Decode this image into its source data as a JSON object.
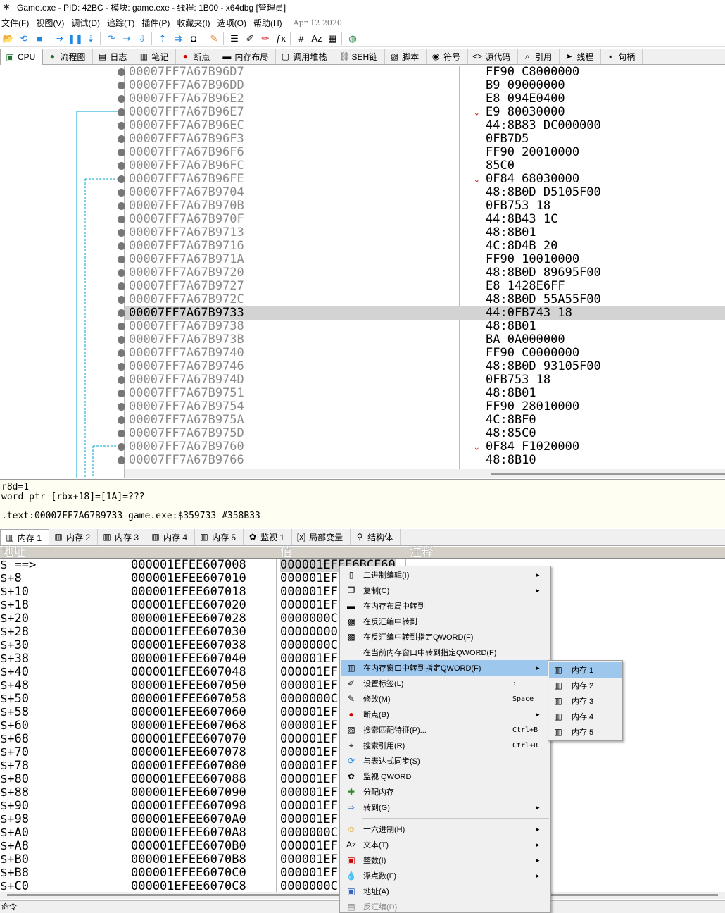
{
  "window": {
    "title": "Game.exe - PID: 42BC - 模块: game.exe - 线程: 1B00 - x64dbg [管理员]"
  },
  "menu": {
    "items": [
      "文件(F)",
      "视图(V)",
      "调试(D)",
      "追踪(T)",
      "插件(P)",
      "收藏夹(I)",
      "选项(O)",
      "帮助(H)"
    ],
    "date": "Apr 12 2020"
  },
  "toolbar": {
    "icons": [
      "open-icon",
      "restart-icon",
      "stop-icon",
      "run-icon",
      "pause-icon",
      "step-into-icon",
      "step-over-icon",
      "trace-into-icon",
      "trace-over-icon",
      "execute-till-return-icon",
      "run-to-user-code-icon",
      "scylla-icon",
      "patch-icon",
      "comment-icon",
      "label-icon",
      "bookmark-icon",
      "function-icon",
      "hash-icon",
      "strings-icon",
      "calculator-icon",
      "globe-icon"
    ]
  },
  "top_tabs": [
    {
      "icon": "cpu-icon",
      "label": "CPU"
    },
    {
      "icon": "graph-icon",
      "label": "流程图"
    },
    {
      "icon": "log-icon",
      "label": "日志"
    },
    {
      "icon": "notes-icon",
      "label": "笔记"
    },
    {
      "icon": "breakpoint-icon",
      "label": "断点"
    },
    {
      "icon": "memory-map-icon",
      "label": "内存布局"
    },
    {
      "icon": "callstack-icon",
      "label": "调用堆栈"
    },
    {
      "icon": "seh-icon",
      "label": "SEH链"
    },
    {
      "icon": "script-icon",
      "label": "脚本"
    },
    {
      "icon": "symbol-icon",
      "label": "符号"
    },
    {
      "icon": "source-icon",
      "label": "源代码"
    },
    {
      "icon": "references-icon",
      "label": "引用"
    },
    {
      "icon": "threads-icon",
      "label": "线程"
    },
    {
      "icon": "handles-icon",
      "label": "句柄"
    }
  ],
  "disasm": {
    "rows": [
      {
        "addr": "00007FF7A67B96D7",
        "bytes": "FF90 C8000000"
      },
      {
        "addr": "00007FF7A67B96DD",
        "bytes": "B9 09000000"
      },
      {
        "addr": "00007FF7A67B96E2",
        "bytes": "E8 094E0400"
      },
      {
        "addr": "00007FF7A67B96E7",
        "bytes": "E9 80030000",
        "jump": true
      },
      {
        "addr": "00007FF7A67B96EC",
        "bytes": "44:8B83 DC000000"
      },
      {
        "addr": "00007FF7A67B96F3",
        "bytes": "0FB7D5"
      },
      {
        "addr": "00007FF7A67B96F6",
        "bytes": "FF90 20010000"
      },
      {
        "addr": "00007FF7A67B96FC",
        "bytes": "85C0"
      },
      {
        "addr": "00007FF7A67B96FE",
        "bytes": "0F84 68030000",
        "jump": true
      },
      {
        "addr": "00007FF7A67B9704",
        "bytes": "48:8B0D D5105F00"
      },
      {
        "addr": "00007FF7A67B970B",
        "bytes": "0FB753 18"
      },
      {
        "addr": "00007FF7A67B970F",
        "bytes": "44:8B43 1C"
      },
      {
        "addr": "00007FF7A67B9713",
        "bytes": "48:8B01"
      },
      {
        "addr": "00007FF7A67B9716",
        "bytes": "4C:8D4B 20"
      },
      {
        "addr": "00007FF7A67B971A",
        "bytes": "FF90 10010000"
      },
      {
        "addr": "00007FF7A67B9720",
        "bytes": "48:8B0D 89695F00"
      },
      {
        "addr": "00007FF7A67B9727",
        "bytes": "E8 1428E6FF"
      },
      {
        "addr": "00007FF7A67B972C",
        "bytes": "48:8B0D 55A55F00"
      },
      {
        "addr": "00007FF7A67B9733",
        "bytes": "44:0FB743 18",
        "current": true
      },
      {
        "addr": "00007FF7A67B9738",
        "bytes": "48:8B01"
      },
      {
        "addr": "00007FF7A67B973B",
        "bytes": "BA 0A000000"
      },
      {
        "addr": "00007FF7A67B9740",
        "bytes": "FF90 C0000000"
      },
      {
        "addr": "00007FF7A67B9746",
        "bytes": "48:8B0D 93105F00"
      },
      {
        "addr": "00007FF7A67B974D",
        "bytes": "0FB753 18"
      },
      {
        "addr": "00007FF7A67B9751",
        "bytes": "48:8B01"
      },
      {
        "addr": "00007FF7A67B9754",
        "bytes": "FF90 28010000"
      },
      {
        "addr": "00007FF7A67B975A",
        "bytes": "4C:8BF0"
      },
      {
        "addr": "00007FF7A67B975D",
        "bytes": "48:85C0"
      },
      {
        "addr": "00007FF7A67B9760",
        "bytes": "0F84 F1020000",
        "jump": true
      },
      {
        "addr": "00007FF7A67B9766",
        "bytes": "48:8B10"
      }
    ]
  },
  "info": {
    "line1": "r8d=1",
    "line2": "word ptr [rbx+18]=[1A]=???",
    "line3": ".text:00007FF7A67B9733 game.exe:$359733 #358B33"
  },
  "bottom_tabs": [
    {
      "icon": "memory-icon",
      "label": "内存 1"
    },
    {
      "icon": "memory-icon",
      "label": "内存 2"
    },
    {
      "icon": "memory-icon",
      "label": "内存 3"
    },
    {
      "icon": "memory-icon",
      "label": "内存 4"
    },
    {
      "icon": "memory-icon",
      "label": "内存 5"
    },
    {
      "icon": "watch-icon",
      "label": "监视 1"
    },
    {
      "icon": "locals-icon",
      "label": "局部变量"
    },
    {
      "icon": "struct-icon",
      "label": "结构体"
    }
  ],
  "memory": {
    "headers": {
      "address": "地址",
      "value": "值",
      "comment": "注释"
    },
    "rows": [
      {
        "off": "$ ==>",
        "addr": "000001EFEE607008",
        "val": "000001EFEE6BCF60"
      },
      {
        "off": "$+8",
        "addr": "000001EFEE607010",
        "val": "000001EF"
      },
      {
        "off": "$+10",
        "addr": "000001EFEE607018",
        "val": "000001EF"
      },
      {
        "off": "$+18",
        "addr": "000001EFEE607020",
        "val": "000001EF"
      },
      {
        "off": "$+20",
        "addr": "000001EFEE607028",
        "val": "0000000C"
      },
      {
        "off": "$+28",
        "addr": "000001EFEE607030",
        "val": "00000000"
      },
      {
        "off": "$+30",
        "addr": "000001EFEE607038",
        "val": "0000000C"
      },
      {
        "off": "$+38",
        "addr": "000001EFEE607040",
        "val": "000001EF"
      },
      {
        "off": "$+40",
        "addr": "000001EFEE607048",
        "val": "000001EF"
      },
      {
        "off": "$+48",
        "addr": "000001EFEE607050",
        "val": "000001EF"
      },
      {
        "off": "$+50",
        "addr": "000001EFEE607058",
        "val": "0000000C"
      },
      {
        "off": "$+58",
        "addr": "000001EFEE607060",
        "val": "000001EF"
      },
      {
        "off": "$+60",
        "addr": "000001EFEE607068",
        "val": "000001EF"
      },
      {
        "off": "$+68",
        "addr": "000001EFEE607070",
        "val": "000001EF"
      },
      {
        "off": "$+70",
        "addr": "000001EFEE607078",
        "val": "000001EF"
      },
      {
        "off": "$+78",
        "addr": "000001EFEE607080",
        "val": "000001EF"
      },
      {
        "off": "$+80",
        "addr": "000001EFEE607088",
        "val": "000001EF"
      },
      {
        "off": "$+88",
        "addr": "000001EFEE607090",
        "val": "000001EF"
      },
      {
        "off": "$+90",
        "addr": "000001EFEE607098",
        "val": "000001EF"
      },
      {
        "off": "$+98",
        "addr": "000001EFEE6070A0",
        "val": "000001EF"
      },
      {
        "off": "$+A0",
        "addr": "000001EFEE6070A8",
        "val": "0000000C"
      },
      {
        "off": "$+A8",
        "addr": "000001EFEE6070B0",
        "val": "000001EF"
      },
      {
        "off": "$+B0",
        "addr": "000001EFEE6070B8",
        "val": "000001EF"
      },
      {
        "off": "$+B8",
        "addr": "000001EFEE6070C0",
        "val": "000001EF"
      },
      {
        "off": "$+C0",
        "addr": "000001EFEE6070C8",
        "val": "0000000C"
      }
    ]
  },
  "command": {
    "label": "命令:"
  },
  "context_menu": {
    "items": [
      {
        "icon": "binary-icon",
        "label": "二进制编辑(I)",
        "arrow": "▸"
      },
      {
        "icon": "copy-icon",
        "label": "复制(C)",
        "arrow": "▸"
      },
      {
        "icon": "memory-map-icon",
        "label": "在内存布局中转到"
      },
      {
        "icon": "disasm-icon",
        "label": "在反汇编中转到"
      },
      {
        "icon": "disasm-qword-icon",
        "label": "在反汇编中转到指定QWORD(F)"
      },
      {
        "icon": "",
        "label": "在当前内存窗口中转到指定QWORD(F)"
      },
      {
        "icon": "memory-icon",
        "label": "在内存窗口中转到指定QWORD(F)",
        "arrow": "▸",
        "selected": true
      },
      {
        "icon": "label-icon",
        "label": "设置标签(L)",
        "shortcut": ":"
      },
      {
        "icon": "pencil-icon",
        "label": "修改(M)",
        "shortcut": "Space"
      },
      {
        "icon": "breakpoint-icon",
        "label": "断点(B)",
        "arrow": "▸"
      },
      {
        "icon": "pattern-icon",
        "label": "搜索匹配特征(P)...",
        "shortcut": "Ctrl+B"
      },
      {
        "icon": "binoculars-icon",
        "label": "搜索引用(R)",
        "shortcut": "Ctrl+R"
      },
      {
        "icon": "sync-icon",
        "label": "与表达式同步(S)"
      },
      {
        "icon": "watch-icon",
        "label": "监视 QWORD"
      },
      {
        "icon": "alloc-icon",
        "label": "分配内存"
      },
      {
        "icon": "goto-icon",
        "label": "转到(G)",
        "arrow": "▸"
      },
      {
        "icon": "hex-icon",
        "label": "十六进制(H)",
        "arrow": "▸",
        "sep_before": true
      },
      {
        "icon": "text-icon",
        "label": "文本(T)",
        "arrow": "▸"
      },
      {
        "icon": "integer-icon",
        "label": "整数(I)",
        "arrow": "▸"
      },
      {
        "icon": "float-icon",
        "label": "浮点数(F)",
        "arrow": "▸"
      },
      {
        "icon": "address-icon",
        "label": "地址(A)"
      },
      {
        "icon": "disassembly-icon",
        "label": "反汇编(D)",
        "disabled": true
      }
    ]
  },
  "submenu": {
    "items": [
      {
        "icon": "memory-icon",
        "label": "内存 1",
        "selected": true
      },
      {
        "icon": "memory-icon",
        "label": "内存 2"
      },
      {
        "icon": "memory-icon",
        "label": "内存 3"
      },
      {
        "icon": "memory-icon",
        "label": "内存 4"
      },
      {
        "icon": "memory-icon",
        "label": "内存 5"
      }
    ]
  },
  "colors": {
    "selection": "#9ec7ee",
    "current_line": "#d3d3d3",
    "address_gray": "#8a8a8a",
    "jump_arrow": "#00a0d0",
    "info_bg": "#fffef2"
  }
}
